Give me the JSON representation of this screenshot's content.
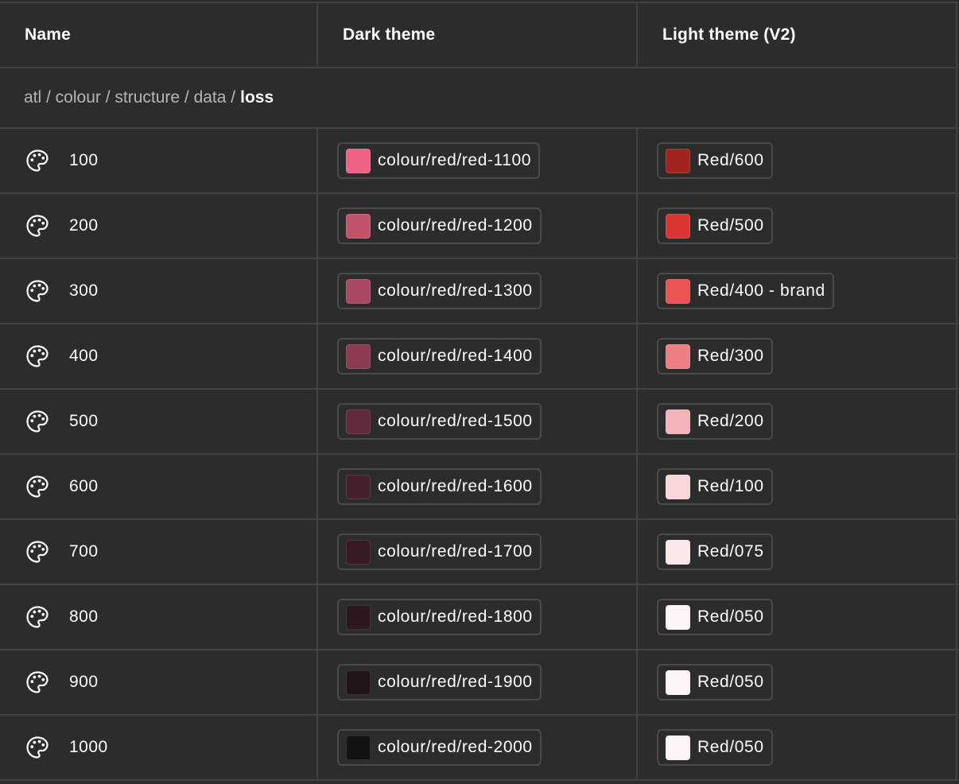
{
  "header": {
    "name": "Name",
    "dark": "Dark theme",
    "light": "Light theme (V2)"
  },
  "group": {
    "path": "atl / colour / structure / data /",
    "leaf": "loss"
  },
  "rows": [
    {
      "name": "100",
      "dark": {
        "label": "colour/red/red-1100",
        "color": "#ee6283"
      },
      "light": {
        "label": "Red/600",
        "color": "#a3241f"
      }
    },
    {
      "name": "200",
      "dark": {
        "label": "colour/red/red-1200",
        "color": "#c1546b"
      },
      "light": {
        "label": "Red/500",
        "color": "#da3633"
      }
    },
    {
      "name": "300",
      "dark": {
        "label": "colour/red/red-1300",
        "color": "#a84862"
      },
      "light": {
        "label": "Red/400 - brand",
        "color": "#ec5454"
      }
    },
    {
      "name": "400",
      "dark": {
        "label": "colour/red/red-1400",
        "color": "#8c3b51"
      },
      "light": {
        "label": "Red/300",
        "color": "#ef7e83"
      }
    },
    {
      "name": "500",
      "dark": {
        "label": "colour/red/red-1500",
        "color": "#602a3a"
      },
      "light": {
        "label": "Red/200",
        "color": "#f2b4b8"
      }
    },
    {
      "name": "600",
      "dark": {
        "label": "colour/red/red-1600",
        "color": "#44212d"
      },
      "light": {
        "label": "Red/100",
        "color": "#f8d6d9"
      }
    },
    {
      "name": "700",
      "dark": {
        "label": "colour/red/red-1700",
        "color": "#361b24"
      },
      "light": {
        "label": "Red/075",
        "color": "#fbe8ea"
      }
    },
    {
      "name": "800",
      "dark": {
        "label": "colour/red/red-1800",
        "color": "#2b171d"
      },
      "light": {
        "label": "Red/050",
        "color": "#fdf4f5"
      }
    },
    {
      "name": "900",
      "dark": {
        "label": "colour/red/red-1900",
        "color": "#21151a"
      },
      "light": {
        "label": "Red/050",
        "color": "#fdf4f5"
      }
    },
    {
      "name": "1000",
      "dark": {
        "label": "colour/red/red-2000",
        "color": "#141214"
      },
      "light": {
        "label": "Red/050",
        "color": "#fdf4f5"
      }
    }
  ]
}
